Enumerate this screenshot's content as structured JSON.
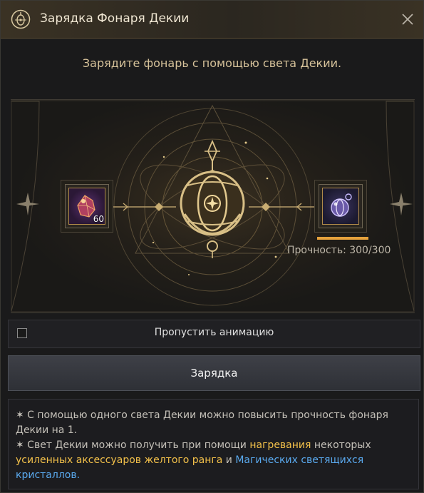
{
  "window": {
    "title": "Зарядка Фонаря Декии",
    "close_icon": "close-icon",
    "title_icon": "lantern-icon"
  },
  "subtitle": "Зарядите фонарь с помощью света Декии.",
  "stage": {
    "input_item": {
      "icon": "deqia-light-icon",
      "count": "60"
    },
    "output_item": {
      "icon": "deqia-lantern-icon"
    },
    "durability": {
      "label": "Прочность: 300/300",
      "current": 300,
      "max": 300
    }
  },
  "skip_animation": {
    "label": "Пропустить анимацию",
    "checked": false
  },
  "charge_button": {
    "label": "Зарядка"
  },
  "notes": {
    "line1": "✶ С помощью одного света Декии можно повысить прочность фонаря Декии на 1.",
    "line2_prefix": "✶ Свет Декии можно получить при помощи ",
    "line2_hl1": "нагревания",
    "line2_mid": " некоторых ",
    "line2_hl2": "усиленных аксессуаров желтого ранга",
    "line2_and": " и ",
    "line2_hl3": "Магических светящихся кристаллов",
    "line2_end": "."
  },
  "colors": {
    "accent_gold": "#e6a23c",
    "highlight_yellow": "#f2c04a",
    "highlight_blue": "#5aa9ee"
  }
}
